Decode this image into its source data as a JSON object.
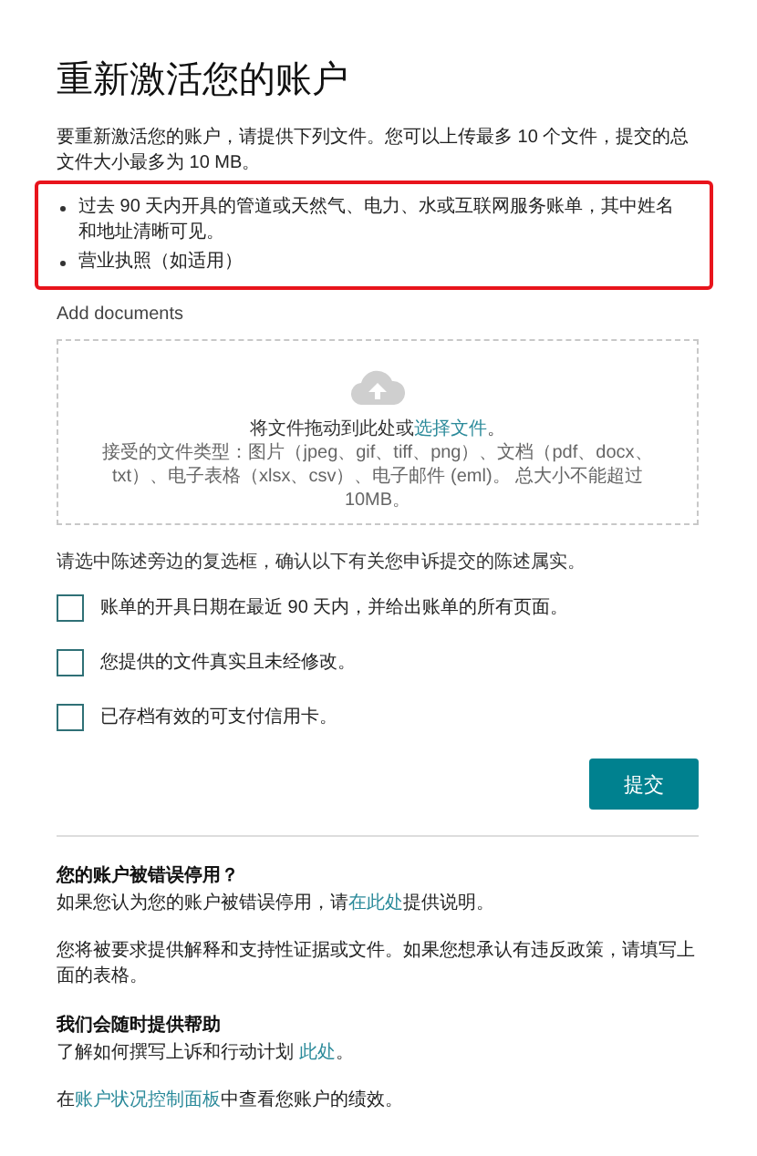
{
  "title": "重新激活您的账户",
  "intro": "要重新激活您的账户，请提供下列文件。您可以上传最多 10 个文件，提交的总文件大小最多为 10 MB。",
  "requirements": [
    "过去 90 天内开具的管道或天然气、电力、水或互联网服务账单，其中姓名和地址清晰可见。",
    "营业执照（如适用）"
  ],
  "upload": {
    "label": "Add documents",
    "prompt_before": "将文件拖动到此处或",
    "prompt_link": "选择文件",
    "prompt_after": "。",
    "accepted": "接受的文件类型：图片（jpeg、gif、tiff、png）、文档（pdf、docx、txt）、电子表格（xlsx、csv）、电子邮件 (eml)。 总大小不能超过 10MB。"
  },
  "confirm_text": "请选中陈述旁边的复选框，确认以下有关您申诉提交的陈述属实。",
  "checkboxes": [
    {
      "label": "账单的开具日期在最近 90 天内，并给出账单的所有页面。",
      "checked": false
    },
    {
      "label": "您提供的文件真实且未经修改。",
      "checked": false
    },
    {
      "label": "已存档有效的可支付信用卡。",
      "checked": false
    }
  ],
  "submit_button": "提交",
  "sections": [
    {
      "heading": "您的账户被错误停用？",
      "paragraphs": [
        {
          "before": "如果您认为您的账户被错误停用，请",
          "link": "在此处",
          "after": "提供说明。"
        },
        {
          "before": "您将被要求提供解释和支持性证据或文件。如果您想承认有违反政策，请填写上面的表格。"
        }
      ]
    },
    {
      "heading": "我们会随时提供帮助",
      "paragraphs": [
        {
          "before": "了解如何撰写上诉和行动计划 ",
          "link": "此处",
          "after": "。"
        },
        {
          "before": "在",
          "link": "账户状况控制面板",
          "after": "中查看您账户的绩效。"
        }
      ]
    }
  ]
}
